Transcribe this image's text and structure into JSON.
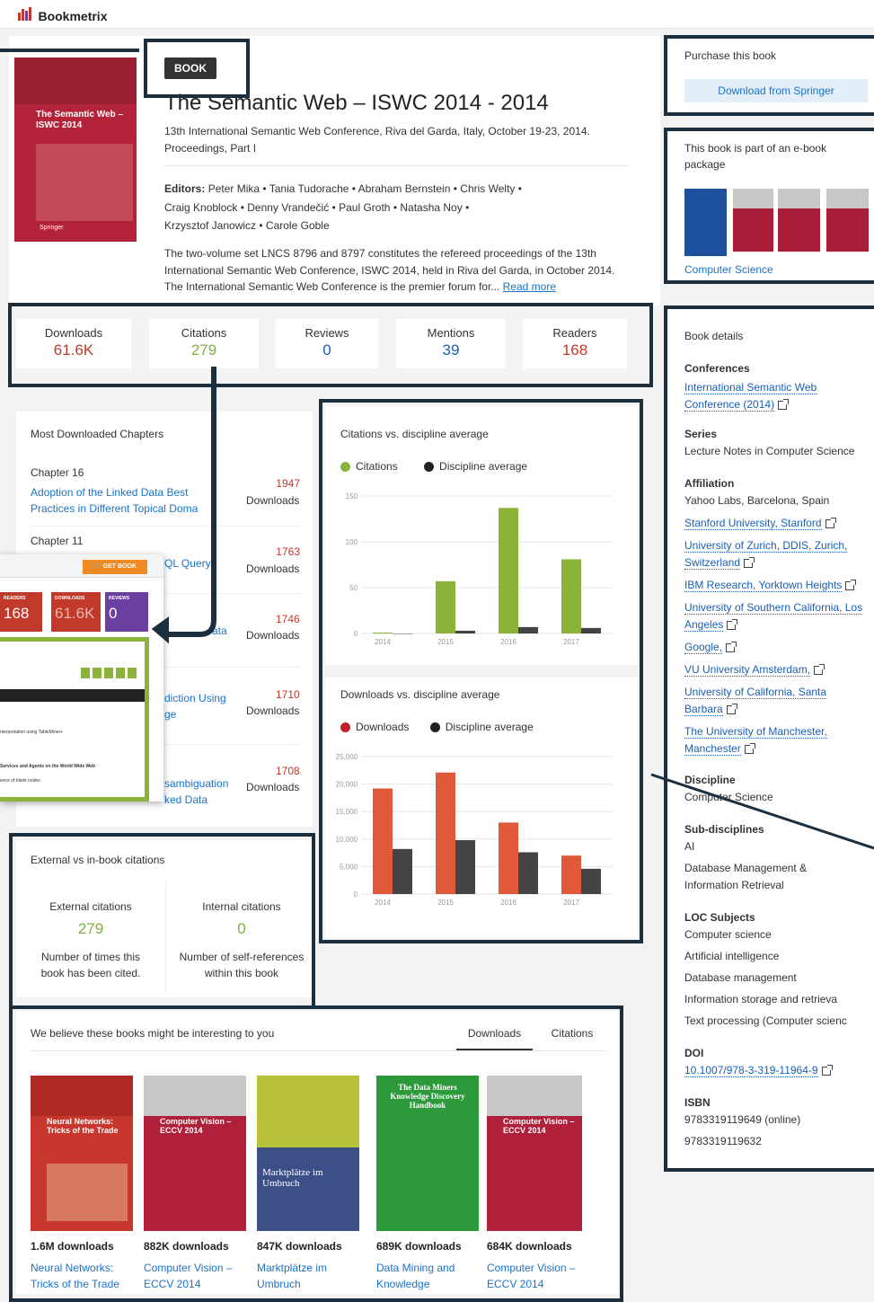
{
  "header": {
    "logo_text": "Bookmetrix"
  },
  "book": {
    "badge": "BOOK",
    "title": "The Semantic Web – ISWC 2014 - 2014",
    "subtitle_line1": "13th International Semantic Web Conference, Riva del Garda, Italy, October 19-23, 2014.",
    "subtitle_line2": "Proceedings, Part I",
    "editors_label": "Editors:",
    "editors": [
      "Peter Mika",
      "Tania Tudorache",
      "Abraham Bernstein",
      "Chris Welty",
      "Craig Knoblock",
      "Denny Vrandečić",
      "Paul Groth",
      "Natasha Noy",
      "Krzysztof Janowicz",
      "Carole Goble"
    ],
    "abstract_line1": "The two-volume set LNCS 8796 and 8797 constitutes the refereed proceedings of the 13th",
    "abstract_line2": "International Semantic Web Conference, ISWC 2014, held in Riva del Garda, in October 2014.",
    "abstract_line3": "The International Semantic Web Conference is the premier forum for...",
    "read_more": "Read more",
    "cover_title": "The Semantic Web – ISWC 2014",
    "cover_publisher": "Springer"
  },
  "stats": [
    {
      "label": "Downloads",
      "value": "61.6K",
      "color": "#c0392b"
    },
    {
      "label": "Citations",
      "value": "279",
      "color": "#7cb342"
    },
    {
      "label": "Reviews",
      "value": "0",
      "color": "#1a5fb4"
    },
    {
      "label": "Mentions",
      "value": "39",
      "color": "#1a5fb4"
    },
    {
      "label": "Readers",
      "value": "168",
      "color": "#c0392b"
    }
  ],
  "purchase": {
    "title": "Purchase this book",
    "button": "Download from Springer"
  },
  "package": {
    "title_line1": "This book is part of an e-book",
    "title_line2": "package",
    "link": "Computer Science"
  },
  "details": {
    "title": "Book details",
    "conferences_h": "Conferences",
    "conference_line1": "International Semantic Web",
    "conference_line2": "Conference (2014)",
    "series_h": "Series",
    "series": "Lecture Notes in Computer Science",
    "affiliation_h": "Affiliation",
    "affiliation_plain": "Yahoo Labs, Barcelona, Spain",
    "affiliations": [
      [
        "Stanford University, Stanford"
      ],
      [
        "University of Zurich, DDIS, Zurich,",
        "Switzerland"
      ],
      [
        "IBM Research, Yorktown Heights"
      ],
      [
        "University of Southern California, Los",
        "Angeles"
      ],
      [
        "Google,"
      ],
      [
        "VU University Amsterdam,"
      ],
      [
        "University of California, Santa",
        "Barbara"
      ],
      [
        "The University of Manchester,",
        "Manchester"
      ]
    ],
    "discipline_h": "Discipline",
    "discipline": "Computer Science",
    "subdisciplines_h": "Sub-disciplines",
    "sub1": "AI",
    "sub2_line1": "Database Management &",
    "sub2_line2": "Information Retrieval",
    "loc_h": "LOC Subjects",
    "loc": [
      "Computer science",
      "Artificial intelligence",
      "Database management",
      "Information storage and retrieva",
      "Text processing (Computer scienc"
    ],
    "doi_h": "DOI",
    "doi": "10.1007/978-3-319-11964-9",
    "isbn_h": "ISBN",
    "isbn_online": "9783319119649 (online)",
    "isbn_print": "9783319119632"
  },
  "chapters": {
    "title": "Most Downloaded Chapters",
    "downloads_label": "Downloads",
    "items": [
      {
        "chapter": "Chapter 16",
        "title_line1": "Adoption of the Linked Data Best",
        "title_line2": "Practices in Different Topical Doma",
        "downloads": "1947"
      },
      {
        "chapter": "Chapter 11",
        "title_line1": "QL Query",
        "title_line2": "",
        "downloads": "1763"
      },
      {
        "chapter": "",
        "title_line1": "ata",
        "title_line2": "",
        "downloads": "1746"
      },
      {
        "chapter": "",
        "title_line1": "diction Using",
        "title_line2": "ge",
        "downloads": "1710"
      },
      {
        "chapter": "",
        "title_line1": "sambiguation",
        "title_line2": "ked Data",
        "downloads": "1708"
      }
    ]
  },
  "popup": {
    "get_book": "GET BOOK",
    "tiles": [
      {
        "label": "READERS",
        "value": "168",
        "color": "#c0392b"
      },
      {
        "label": "DOWNLOADS",
        "value": "61.6K",
        "color": "#c0392b"
      },
      {
        "label": "REVIEWS",
        "value": "0",
        "color": "#6a3fa0"
      }
    ],
    "line1": "nterpretation using TableMiner+",
    "line2": "Services and Agents on the World Wide Web",
    "line3": "ence of blank nodes"
  },
  "citations_chart": {
    "title": "Citations vs. discipline average",
    "legend": [
      "Citations",
      "Discipline average"
    ]
  },
  "downloads_chart": {
    "title": "Downloads vs. discipline average",
    "legend": [
      "Downloads",
      "Discipline average"
    ]
  },
  "chart_data": [
    {
      "type": "bar",
      "title": "Citations vs. discipline average",
      "categories": [
        "2014",
        "2015",
        "2016",
        "2017"
      ],
      "series": [
        {
          "name": "Citations",
          "values": [
            1,
            57,
            137,
            81
          ],
          "color": "#8bb33a"
        },
        {
          "name": "Discipline average",
          "values": [
            0,
            3,
            7,
            6
          ],
          "color": "#444444"
        }
      ],
      "ylim": [
        0,
        150
      ],
      "yticks": [
        "0",
        "50",
        "100",
        "150"
      ],
      "legend": "top-left",
      "grid": true
    },
    {
      "type": "bar",
      "title": "Downloads vs. discipline average",
      "categories": [
        "2014",
        "2015",
        "2016",
        "2017"
      ],
      "series": [
        {
          "name": "Downloads",
          "values": [
            19200,
            22100,
            13000,
            7000
          ],
          "color": "#e05a3a"
        },
        {
          "name": "Discipline average",
          "values": [
            8200,
            9800,
            7600,
            4600
          ],
          "color": "#444444"
        }
      ],
      "ylim": [
        0,
        25000
      ],
      "yticks": [
        "0",
        "5,000",
        "10,000",
        "15,000",
        "20,000",
        "25,000"
      ],
      "legend": "top-left",
      "grid": true
    }
  ],
  "ext_cit": {
    "title": "External vs in-book citations",
    "external_label": "External citations",
    "external_value": "279",
    "external_desc_line1": "Number of times this",
    "external_desc_line2": "book has been cited.",
    "internal_label": "Internal citations",
    "internal_value": "0",
    "internal_desc_line1": "Number of self-references",
    "internal_desc_line2": "within this book"
  },
  "recommend": {
    "title": "We believe these books might be interesting to you",
    "tabs": [
      "Downloads",
      "Citations"
    ],
    "books": [
      {
        "downloads": "1.6M downloads",
        "title_line1": "Neural Networks:",
        "title_line2": "Tricks of the Trade",
        "cover_text": "Neural Networks: Tricks of the Trade",
        "cover_color": "#c8372d"
      },
      {
        "downloads": "882K downloads",
        "title_line1": "Computer Vision –",
        "title_line2": "ECCV 2014",
        "cover_text": "Computer Vision – ECCV 2014",
        "cover_color": "#b0203a"
      },
      {
        "downloads": "847K downloads",
        "title_line1": "Marktplätze im",
        "title_line2": "Umbruch",
        "cover_text": "Marktplätze im Umbruch",
        "cover_color": "#3c4f86"
      },
      {
        "downloads": "689K downloads",
        "title_line1": "Data Mining and",
        "title_line2": "Knowledge",
        "cover_text": "The Data Miners Knowledge Discovery Handbook",
        "cover_color": "#2c9a3a"
      },
      {
        "downloads": "684K downloads",
        "title_line1": "Computer Vision –",
        "title_line2": "ECCV 2014",
        "cover_text": "Computer Vision – ECCV 2014",
        "cover_color": "#b0203a"
      }
    ]
  }
}
